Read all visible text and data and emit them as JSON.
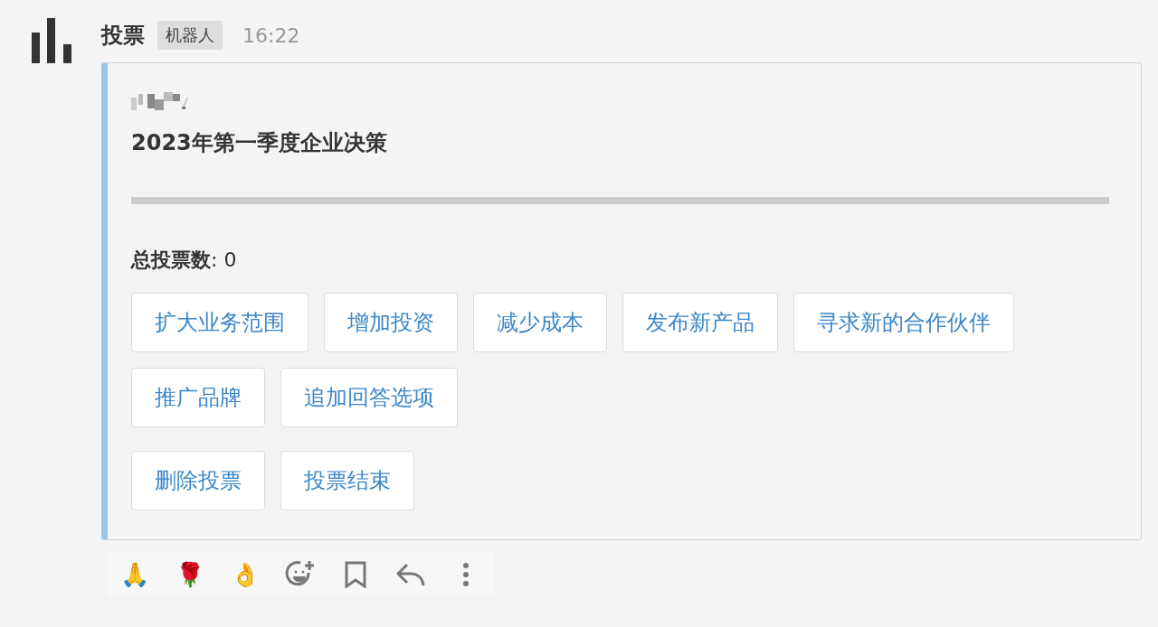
{
  "message": {
    "sender": "投票",
    "badge": "机器人",
    "time": "16:22"
  },
  "poll": {
    "title": "2023年第一季度企业决策",
    "progress": {
      "level": 0
    },
    "total": "**总投票数**: 0",
    "options": [
      "扩大业务范围",
      "增加投资",
      "减少成本",
      "发布新产品",
      "寻求新的合作伙伴",
      "推广品牌"
    ],
    "add_option": "追加回答选项",
    "actions": [
      "删除投票",
      "投票结束"
    ]
  },
  "reactions": [
    "🙏",
    "🌹",
    "👌"
  ],
  "tools": [
    {
      "kind": "emoji-add"
    },
    {
      "kind": "bookmark"
    },
    {
      "kind": "reply"
    },
    {
      "kind": "more"
    }
  ]
}
